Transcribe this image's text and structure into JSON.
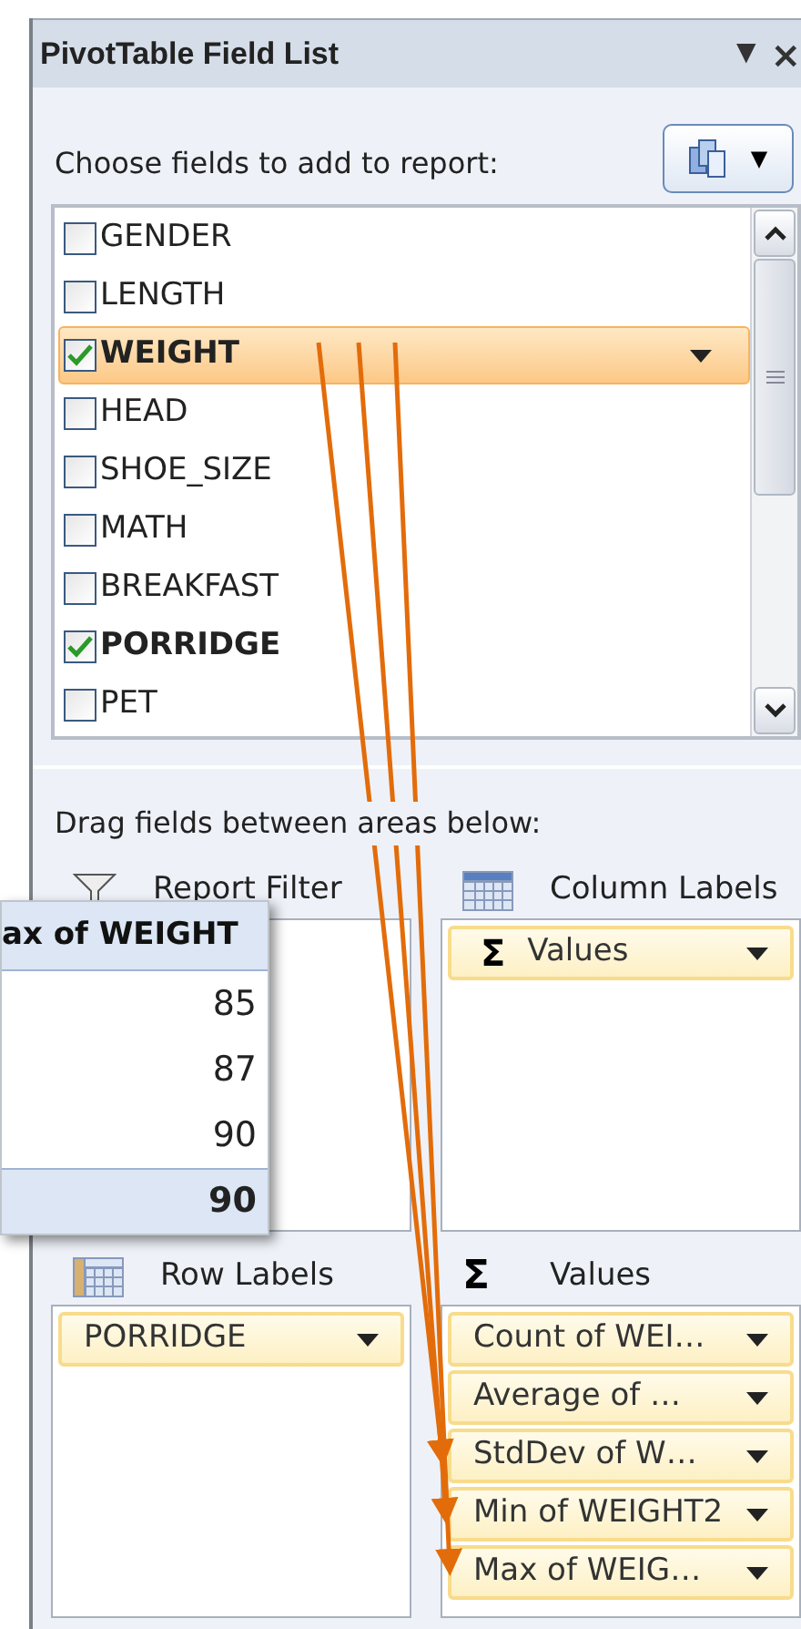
{
  "window": {
    "title": "PivotTable Field List",
    "menu_glyph": "▼",
    "close_glyph": "×"
  },
  "choose_label": "Choose fields to add to report:",
  "layout_button": {
    "caret": "▼"
  },
  "fields": [
    {
      "label": "GENDER",
      "checked": false,
      "selected": false
    },
    {
      "label": "LENGTH",
      "checked": false,
      "selected": false
    },
    {
      "label": "WEIGHT",
      "checked": true,
      "selected": true
    },
    {
      "label": "HEAD",
      "checked": false,
      "selected": false
    },
    {
      "label": "SHOE_SIZE",
      "checked": false,
      "selected": false
    },
    {
      "label": "MATH",
      "checked": false,
      "selected": false
    },
    {
      "label": "BREAKFAST",
      "checked": false,
      "selected": false
    },
    {
      "label": "PORRIDGE",
      "checked": true,
      "selected": false
    },
    {
      "label": "PET",
      "checked": false,
      "selected": false
    }
  ],
  "drag_label": "Drag fields between areas below:",
  "areas": [
    {
      "kind": "filter",
      "title": "Report Filter"
    },
    {
      "kind": "columns",
      "title": "Column Labels",
      "items": [
        {
          "label": "Values",
          "sigma": "Σ"
        }
      ]
    },
    {
      "kind": "rows",
      "title": "Row Labels",
      "items": [
        {
          "label": "PORRIDGE"
        }
      ]
    },
    {
      "kind": "values",
      "title": "Values",
      "sigma": "Σ",
      "items": [
        {
          "label": "Count of WEI…"
        },
        {
          "label": "Average of …"
        },
        {
          "label": "StdDev of W…"
        },
        {
          "label": "Min of WEIGHT2"
        },
        {
          "label": "Max of WEIG…"
        }
      ]
    }
  ],
  "popup": {
    "header": "ax of WEIGHT",
    "rows": [
      {
        "value": "85",
        "selected": false
      },
      {
        "value": "87",
        "selected": false
      },
      {
        "value": "90",
        "selected": false
      },
      {
        "value": "90",
        "selected": true
      }
    ]
  }
}
